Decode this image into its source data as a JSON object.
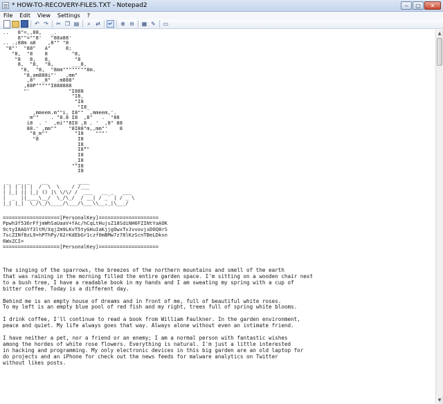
{
  "window": {
    "title": "* HOW-TO-RECOVERY-FILES.TXT - Notepad2",
    "minimize_glyph": "‒",
    "maximize_glyph": "□",
    "close_glyph": "✕"
  },
  "menu": [
    "File",
    "Edit",
    "View",
    "Settings",
    "?"
  ],
  "toolbar": {
    "buttons": [
      {
        "name": "new-file",
        "icon": "new-file-icon"
      },
      {
        "name": "open-file",
        "icon": "open-folder-icon"
      },
      {
        "name": "save-file",
        "icon": "save-icon"
      },
      {
        "name": "undo",
        "icon": "undo-icon",
        "glyph": "↶"
      },
      {
        "name": "redo",
        "icon": "redo-icon",
        "glyph": "↷"
      },
      {
        "name": "cut",
        "icon": "cut-icon",
        "glyph": "✂"
      },
      {
        "name": "copy",
        "icon": "copy-icon",
        "glyph": "❐"
      },
      {
        "name": "paste",
        "icon": "paste-icon",
        "glyph": "▤"
      },
      {
        "name": "find",
        "icon": "find-icon",
        "glyph": "⌕"
      },
      {
        "name": "replace",
        "icon": "replace-icon",
        "glyph": "⇄"
      },
      {
        "name": "word-wrap",
        "icon": "word-wrap-icon",
        "glyph": "↵"
      },
      {
        "name": "zoom-in",
        "icon": "zoom-in-icon",
        "glyph": "⊕"
      },
      {
        "name": "zoom-out",
        "icon": "zoom-out-icon",
        "glyph": "⊖"
      },
      {
        "name": "scheme",
        "icon": "scheme-icon",
        "glyph": "▦"
      },
      {
        "name": "settings",
        "icon": "settings-icon",
        "glyph": "✎"
      },
      {
        "name": "exit",
        "icon": "exit-icon",
        "glyph": "▭"
      }
    ]
  },
  "scrollbar": {
    "up": "▲",
    "down": "▼"
  },
  "content": {
    "ascii_art": "..   8\"=,,88,   _.\n     8\"\"=\"\"8'   \"88a88'\n.. .;88m a8    ,8\"\" \"8\n \"8\"'  \"88\"   A\"     8;\n   \"8,  \"8    8        \"8,\n    \"8   8,   8,        \"8\n     8,  \"8,  \"8,      ___8,\n      \"8,  \"8,  \"8mm\"\"\"\"\"\"\"\"8m.\n       \"8,am888i\"'   ,mm\"\n        ,8\"  _8\"  .m888\"\n       ,88P\"\"\"\"\"I888888\n       \"'             \"I888\n                       \"I8,\n                        \"I8\n                         \"I8_\n          ,mmeem.m\"\"i, I8\"\"  ,mmeem,'.\n         m\"\"    . \"8.8 I8  ,8\"   .  \"88\n        i8  . '  ,mi\"\"8I8 ,8 . '  ,8\" 88\n        88.' ,mm\"\"    \"8I88\"m,,mm\"'    8\n         \"8_m\"\"         \"I8    \"\"\"'\n          \"8             I8\n                         I8_\n                         I8\"\"\n                         I8\n                        _I8\n                       \"\"I8\n                         I8\n\n _   _  _    __          ____\n| | | || |  /  \\  \\    / /___\n| |_| || |_| () |\\ \\/\\/ /  ___   __ _   ___\n|  _  ||____\\__/  \\_/\\_/  / __| / _` | / _ \\\n|_| |_|  \\_/\\_/\\____/\\___/\\___\\\\__,_|\\___/",
    "key_header": "===================[PersonalKey]====================",
    "key_lines": "Ppwh3f536rFfjmWhSaUaaV+fAc/hCqLtHujsZ18SdiNH6FZINtYaAOK\n9ctyI8AGYf3ltM/XqjZm9LKvT5tyGHuIaKjjgOwxTvJvvovjxDOQ8rS\n7scZINf8zL9+hPThPy/62rKdEbGr1czf0mBMw7z78lKzScnTBeLDksn\n6WxZCI=",
    "key_footer": "===================[PersonalKey]====================",
    "body": "The singing of the sparrows, the breezes of the northern mountains and smell of the earth\nthat was raining in the morning filled the entire garden space. I'm sitting on a wooden chair next\nto a bush tree, I have a readable book in my hands and I am sweating my spring with a cup of\nbitter coffee. Today is a different day.\n\nBehind me is an empty house of dreams and in front of me, full of beautiful white roses.\nTo my left is an empty blue pool of red fish and my right, trees full of spring white blooms.\n\nI drink coffee, I'll continue to read a book from William Faulkner. In the garden environment,\npeace and quiet. My life always goes that way. Always alone without even an intimate friend.\n\nI have neither a pet, nor a friend or an enemy; I am a normal person with fantastic wishes\namong the hordes of white rose flowers. Everything is natural. I'm just a little interested\nin hacking and programming. My only electronic devices in this big garden are an old laptop for\ndo projects and an iPhone for check out the news feeds for malware analytics on Twitter\nwithout likes posts."
  }
}
